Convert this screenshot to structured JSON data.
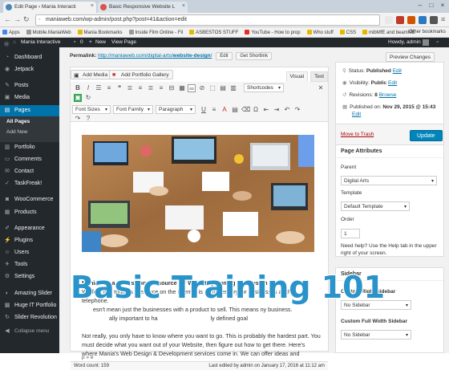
{
  "browser": {
    "tabs": [
      {
        "title": "Edit Page ‹ Mania Interacti"
      },
      {
        "title": "Basic Responsive Website L"
      }
    ],
    "url": "maniaweb.com/wp-admin/post.php?post=41&action=edit",
    "bookmarks": [
      "Apps",
      "Mobile.ManiaWeb",
      "Mania Bookmarks",
      "Inside Film Online - Fil",
      "ASBESTOS STUFF",
      "YouTube - How to prop",
      "Who stuff",
      "CSS",
      "mibMfE and beamME"
    ],
    "other_bookmarks": "Other bookmarks"
  },
  "admin_bar": {
    "site_name": "Mania Interactive",
    "comments_count": "0",
    "new_label": "New",
    "view_page": "View Page",
    "howdy": "Howdy, admin"
  },
  "sidebar": {
    "items": [
      {
        "label": "Dashboard",
        "icon": "dashboard-icon"
      },
      {
        "label": "Jetpack",
        "icon": "jetpack-icon"
      },
      {
        "label": "Posts",
        "icon": "pin-icon"
      },
      {
        "label": "Media",
        "icon": "media-icon"
      },
      {
        "label": "Pages",
        "icon": "pages-icon"
      },
      {
        "label": "Portfolio",
        "icon": "portfolio-icon"
      },
      {
        "label": "Comments",
        "icon": "comments-icon"
      },
      {
        "label": "Contact",
        "icon": "contact-icon"
      },
      {
        "label": "TaskFreak!",
        "icon": "task-icon"
      },
      {
        "label": "WooCommerce",
        "icon": "woo-icon"
      },
      {
        "label": "Products",
        "icon": "products-icon"
      },
      {
        "label": "Appearance",
        "icon": "appearance-icon"
      },
      {
        "label": "Plugins",
        "icon": "plugins-icon"
      },
      {
        "label": "Users",
        "icon": "users-icon"
      },
      {
        "label": "Tools",
        "icon": "tools-icon"
      },
      {
        "label": "Settings",
        "icon": "settings-icon"
      },
      {
        "label": "Amazing Slider",
        "icon": "slider-icon"
      },
      {
        "label": "Huge IT Portfolio",
        "icon": "huge-icon"
      },
      {
        "label": "Slider Revolution",
        "icon": "revslider-icon"
      },
      {
        "label": "Collapse menu",
        "icon": "collapse-icon"
      }
    ],
    "submenu": [
      "All Pages",
      "Add New"
    ]
  },
  "permalink": {
    "label": "Permalink:",
    "url_prefix": "http://maniaweb.com/digital-arts/",
    "slug": "website-design",
    "url_suffix": "/",
    "edit": "Edit",
    "get_shortlink": "Get Shortlink"
  },
  "editor": {
    "add_media": "Add Media",
    "add_portfolio": "Add Portfolio Gallery",
    "tab_visual": "Visual",
    "tab_text": "Text",
    "shortcodes": "Shortcodes",
    "font_sizes": "Font Sizes",
    "font_family": "Font Family",
    "paragraph": "Paragraph",
    "body_heading": "Mania™ is a professional resource for Website planning and design",
    "body_lines": [
      "We feel that today a presence on the Internet is as necessary for businesses as the telephone.",
      "       esn't mean just the businesses with a product to sell. This means ny business.",
      "                 ally important to ha                                 ly defined goal",
      "",
      "Not really, you only have to know where you want to go. This is probably the hardest part. You",
      "must decide what you want out of your Website, then figure out how to get there. Here's",
      "where Mania's Web Design & Development services come in. We can offer ideas and"
    ],
    "path": "p » e",
    "word_count": "Word count: 159",
    "last_edited": "Last edited by admin on January 17, 2016 at 11:12 am"
  },
  "overlay_text": "Basic Training 101",
  "publish": {
    "preview": "Preview Changes",
    "status_label": "Status:",
    "status_value": "Published",
    "edit": "Edit",
    "visibility_label": "Visibility:",
    "visibility_value": "Public",
    "revisions_label": "Revisions:",
    "revisions_value": "8",
    "browse": "Browse",
    "published_label": "Published on:",
    "published_value": "Nov 29, 2015 @ 15:43",
    "move_trash": "Move to Trash",
    "update": "Update"
  },
  "page_attributes": {
    "title": "Page Attributes",
    "parent_label": "Parent",
    "parent_value": "Digital Arts",
    "template_label": "Template",
    "template_value": "Default Template",
    "order_label": "Order",
    "order_value": "1",
    "help": "Need help? Use the Help tab in the upper right of your screen."
  },
  "sidebar_box": {
    "title": "Sidebar",
    "custom_right": "Custom Right Sidebar",
    "custom_right_value": "No Sidebar",
    "custom_full": "Custom Full Width Sidebar",
    "custom_full_value": "No Sidebar"
  },
  "colors": {
    "admin_dark": "#23282d",
    "accent": "#0073aa",
    "overlay": "#2a93c9"
  }
}
